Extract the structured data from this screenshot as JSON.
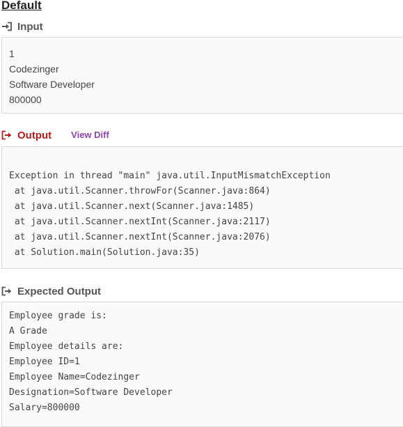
{
  "title": "Default",
  "input": {
    "label": "Input",
    "icon": "sign-in-icon",
    "lines": [
      "1",
      "Codezinger",
      "Software Developer",
      "800000"
    ]
  },
  "output": {
    "label": "Output",
    "icon": "sign-out-icon",
    "view_diff": "View Diff",
    "lines": [
      "Exception in thread \"main\" java.util.InputMismatchException",
      " at java.util.Scanner.throwFor(Scanner.java:864)",
      " at java.util.Scanner.next(Scanner.java:1485)",
      " at java.util.Scanner.nextInt(Scanner.java:2117)",
      " at java.util.Scanner.nextInt(Scanner.java:2076)",
      " at Solution.main(Solution.java:35)"
    ]
  },
  "expected": {
    "label": "Expected Output",
    "icon": "sign-out-icon",
    "lines": [
      "Employee grade is:",
      "A Grade",
      "Employee details are:",
      "Employee ID=1",
      "Employee Name=Codezinger",
      "Designation=Software Developer",
      "Salary=800000"
    ]
  },
  "colors": {
    "output_label": "#b71c1c",
    "view_diff": "#8e44ad",
    "panel_bg": "#fafafa",
    "panel_border": "#d9d9d9"
  }
}
